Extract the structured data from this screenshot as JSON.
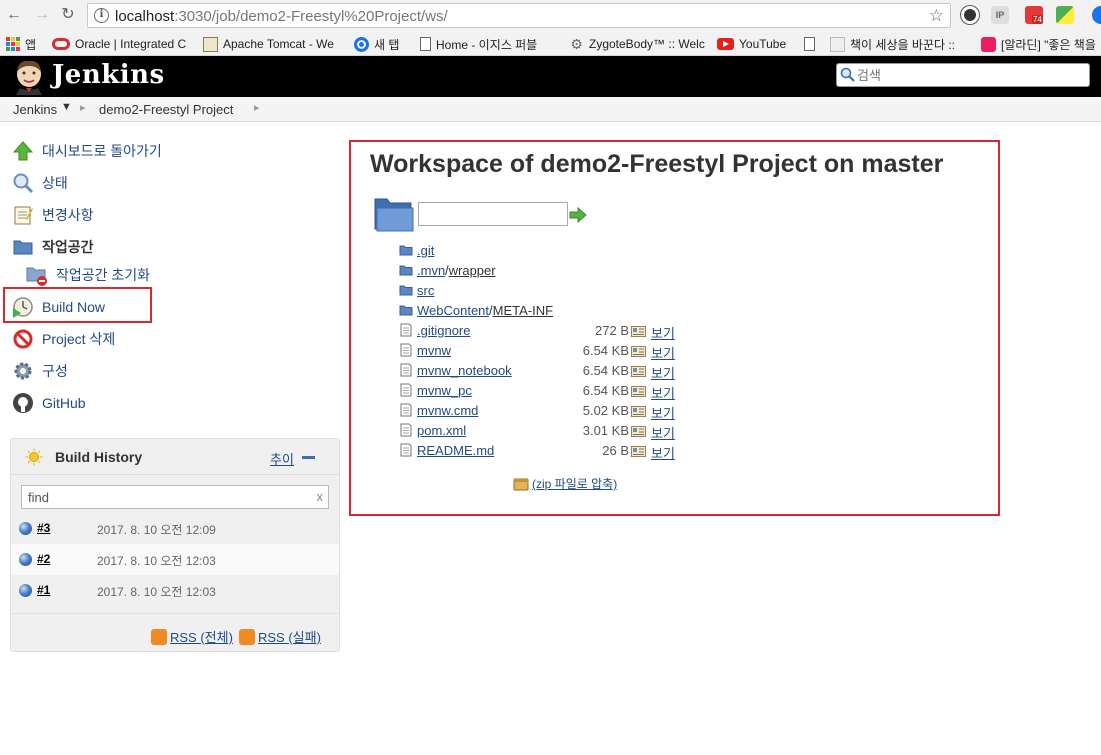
{
  "browser": {
    "url_host": "localhost",
    "url_rest": ":3030/job/demo2-Freestyl%20Project/ws/",
    "ext_badge": "74",
    "bookmarks": [
      {
        "label": "앱",
        "icon": "apps-grid-icon"
      },
      {
        "label": "Oracle | Integrated C",
        "icon": "oracle-icon"
      },
      {
        "label": "Apache Tomcat - We",
        "icon": "tomcat-icon"
      },
      {
        "label": "새 탭",
        "icon": "new-tab-icon"
      },
      {
        "label": "Home - 이지스 퍼블",
        "icon": "page-icon"
      },
      {
        "label": "ZygoteBody™ :: Welc",
        "icon": "zygote-icon"
      },
      {
        "label": "YouTube",
        "icon": "youtube-icon"
      },
      {
        "label": "책이 세상을 바꾼다 ::",
        "icon": "page-icon"
      },
      {
        "label": "[알라딘] \"좋은 책을",
        "icon": "aladin-icon"
      }
    ]
  },
  "header": {
    "logo_text": "Jenkins",
    "search_placeholder": "검색"
  },
  "breadcrumb": {
    "root": "Jenkins",
    "project": "demo2-Freestyl Project"
  },
  "tasks": [
    {
      "label": "대시보드로 돌아가기",
      "icon": "up-arrow-icon"
    },
    {
      "label": "상태",
      "icon": "search-icon"
    },
    {
      "label": "변경사항",
      "icon": "notepad-icon"
    },
    {
      "label": "작업공간",
      "icon": "folder-icon"
    },
    {
      "label": "작업공간 초기화",
      "icon": "folder-delete-icon"
    },
    {
      "label": "Build Now",
      "icon": "clock-play-icon"
    },
    {
      "label": "Project 삭제",
      "icon": "no-entry-icon"
    },
    {
      "label": "구성",
      "icon": "gear-icon"
    },
    {
      "label": "GitHub",
      "icon": "github-icon"
    }
  ],
  "build_history": {
    "title": "Build History",
    "trend_label": "추이",
    "filter_value": "find",
    "clear_label": "x",
    "builds": [
      {
        "number": "#3",
        "date": "2017. 8. 10 오전 12:09"
      },
      {
        "number": "#2",
        "date": "2017. 8. 10 오전 12:03"
      },
      {
        "number": "#1",
        "date": "2017. 8. 10 오전 12:03"
      }
    ],
    "rss_all": "RSS (전체)",
    "rss_failed": "RSS (실패)"
  },
  "workspace": {
    "title": "Workspace of demo2-Freestyl Project on master",
    "path_value": "",
    "dirs": [
      {
        "name": ".git",
        "suffix": ""
      },
      {
        "name": ".mvn",
        "suffix": "wrapper"
      },
      {
        "name": "src",
        "suffix": ""
      },
      {
        "name": "WebContent",
        "suffix": "META-INF"
      }
    ],
    "files": [
      {
        "name": ".gitignore",
        "size": "272 B",
        "view": "보기"
      },
      {
        "name": "mvnw",
        "size": "6.54 KB",
        "view": "보기"
      },
      {
        "name": "mvnw_notebook",
        "size": "6.54 KB",
        "view": "보기"
      },
      {
        "name": "mvnw_pc",
        "size": "6.54 KB",
        "view": "보기"
      },
      {
        "name": "mvnw.cmd",
        "size": "5.02 KB",
        "view": "보기"
      },
      {
        "name": "pom.xml",
        "size": "3.01 KB",
        "view": "보기"
      },
      {
        "name": "README.md",
        "size": "26 B",
        "view": "보기"
      }
    ],
    "zip_label": "(zip 파일로 압축)"
  },
  "colors": {
    "link": "#204a87",
    "highlight": "#d9262f",
    "header_bg": "#000000"
  }
}
